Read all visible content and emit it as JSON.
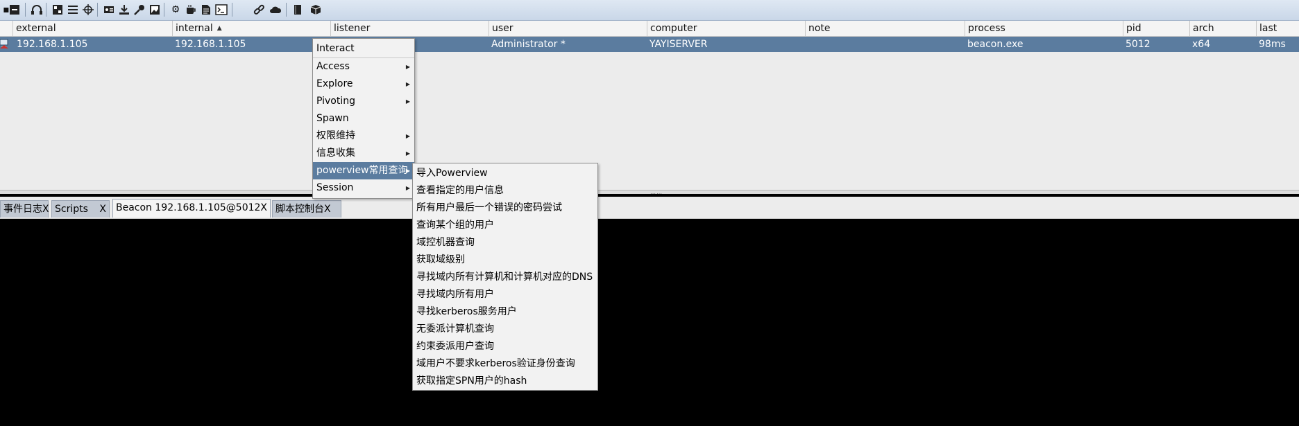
{
  "toolbar": {
    "icons": [
      "minus-box-icon",
      "headphones-icon",
      "connect-icon",
      "list-icon",
      "target-icon",
      "credentials-icon",
      "download-icon",
      "key-icon",
      "image-icon",
      "gear-icon",
      "coffee-icon",
      "document-icon",
      "terminal-icon",
      "link-icon",
      "cloud-icon",
      "book-icon",
      "package-icon"
    ]
  },
  "table": {
    "columns": [
      "external",
      "internal",
      "listener",
      "user",
      "computer",
      "note",
      "process",
      "pid",
      "arch",
      "last"
    ],
    "sort_column": "internal",
    "rows": [
      {
        "external": "192.168.1.105",
        "internal": "192.168.1.105",
        "listener": "",
        "user": "Administrator *",
        "computer": "YAYISERVER",
        "note": "",
        "process": "beacon.exe",
        "pid": "5012",
        "arch": "x64",
        "last": "98ms"
      }
    ]
  },
  "tabs": [
    {
      "label": "事件日志",
      "close": "X"
    },
    {
      "label": "Scripts",
      "close": "X"
    },
    {
      "label": "Beacon 192.168.1.105@5012",
      "close": "X"
    },
    {
      "label": "脚本控制台",
      "close": "X"
    }
  ],
  "context_menu": {
    "items": [
      {
        "label": "Interact",
        "submenu": false
      },
      {
        "label": "Access",
        "submenu": true
      },
      {
        "label": "Explore",
        "submenu": true
      },
      {
        "label": "Pivoting",
        "submenu": true
      },
      {
        "label": "Spawn",
        "submenu": false
      },
      {
        "label": "权限维持",
        "submenu": true
      },
      {
        "label": "信息收集",
        "submenu": true
      },
      {
        "label": "powerview常用查询",
        "submenu": true
      },
      {
        "label": "Session",
        "submenu": true
      }
    ],
    "selected": "powerview常用查询"
  },
  "submenu": {
    "items": [
      "导入Powerview",
      "查看指定的用户信息",
      "所有用户最后一个错误的密码尝试",
      "查询某个组的用户",
      "域控机器查询",
      "获取域级别",
      "寻找域内所有计算机和计算机对应的DNS",
      "寻找域内所有用户",
      "寻找kerberos服务用户",
      "无委派计算机查询",
      "约束委派用户查询",
      "域用户不要求kerberos验证身份查询",
      "获取指定SPN用户的hash"
    ]
  },
  "colors": {
    "selection": "#5b7c9f",
    "console_bg": "#000000",
    "toolbar": "#c9d7e8"
  }
}
